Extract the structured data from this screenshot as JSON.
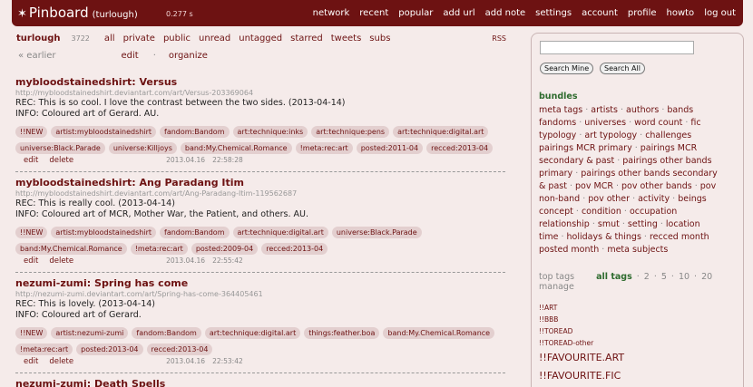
{
  "header": {
    "logo": "Pinboard",
    "username": "(turlough)",
    "timing": "0.277 s",
    "nav": [
      "network",
      "recent",
      "popular",
      "add url",
      "add note",
      "settings",
      "account",
      "profile",
      "howto",
      "log out"
    ]
  },
  "subbar": {
    "username": "turlough",
    "count": "3722",
    "filters": [
      "all",
      "private",
      "public",
      "unread",
      "untagged",
      "starred",
      "tweets",
      "subs"
    ],
    "rss": "RSS"
  },
  "pager": {
    "earlier": "« earlier",
    "edit": "edit",
    "dot": "·",
    "organize": "organize"
  },
  "bookmarks": [
    {
      "title": "mybloodstainedshirt: Versus",
      "url": "http://mybloodstainedshirt.deviantart.com/art/Versus-203369064",
      "desc": [
        "REC: This is so cool. I love the contrast between the two sides. (2013-04-14)",
        "INFO: Coloured art of Gerard. AU."
      ],
      "tags": [
        "!!NEW",
        "artist:mybloodstainedshirt",
        "fandom:Bandom",
        "art:technique:inks",
        "art:technique:pens",
        "art:technique:digital.art",
        "universe:Black.Parade",
        "universe:Killjoys",
        "band:My.Chemical.Romance",
        "!meta:rec:art",
        "posted:2011-04",
        "recced:2013-04"
      ],
      "edit": "edit",
      "delete": "delete",
      "date": "2013.04.16",
      "time": "22:58:28"
    },
    {
      "title": "mybloodstainedshirt: Ang Paradang Itim",
      "url": "http://mybloodstainedshirt.deviantart.com/art/Ang-Paradang-Itim-119562687",
      "desc": [
        "REC: This is really cool. (2013-04-14)",
        "INFO: Coloured art of MCR, Mother War, the Patient, and others. AU."
      ],
      "tags": [
        "!!NEW",
        "artist:mybloodstainedshirt",
        "fandom:Bandom",
        "art:technique:digital.art",
        "universe:Black.Parade",
        "band:My.Chemical.Romance",
        "!meta:rec:art",
        "posted:2009-04",
        "recced:2013-04"
      ],
      "edit": "edit",
      "delete": "delete",
      "date": "2013.04.16",
      "time": "22:55:42"
    },
    {
      "title": "nezumi-zumi: Spring has come",
      "url": "http://nezumi-zumi.deviantart.com/art/Spring-has-come-364405461",
      "desc": [
        "REC: This is lovely. (2013-04-14)",
        "INFO: Coloured art of Gerard."
      ],
      "tags": [
        "!!NEW",
        "artist:nezumi-zumi",
        "fandom:Bandom",
        "art:technique:digital.art",
        "things:feather.boa",
        "band:My.Chemical.Romance",
        "!meta:rec:art",
        "posted:2013-04",
        "recced:2013-04"
      ],
      "edit": "edit",
      "delete": "delete",
      "date": "2013.04.16",
      "time": "22:53:42"
    },
    {
      "title": "nezumi-zumi: Death Spells",
      "url": "",
      "desc": [],
      "tags": [],
      "edit": "",
      "delete": "",
      "date": "",
      "time": ""
    }
  ],
  "sidebar": {
    "search_placeholder": "",
    "search_mine": "Search Mine",
    "search_all": "Search All",
    "bundles_heading": "bundles",
    "bundle_lines": [
      [
        "meta tags",
        "artists",
        "authors",
        "bands"
      ],
      [
        "fandoms",
        "universes",
        "word count",
        "fic"
      ],
      [
        "typology",
        "art typology",
        "challenges"
      ],
      [
        "pairings MCR primary",
        "pairings MCR"
      ],
      [
        "secondary & past",
        "pairings other bands"
      ],
      [
        "primary",
        "pairings other bands secondary"
      ],
      [
        "& past",
        "pov MCR",
        "pov other bands",
        "pov"
      ],
      [
        "non-band",
        "pov other",
        "activity",
        "beings"
      ],
      [
        "concept",
        "condition",
        "occupation"
      ],
      [
        "relationship",
        "smut",
        "setting",
        "location"
      ],
      [
        "time",
        "holidays & things",
        "recced month"
      ],
      [
        "posted month",
        "meta subjects"
      ]
    ],
    "tag_nav": {
      "top": "top tags",
      "all": "all tags",
      "counts": [
        "2",
        "5",
        "10",
        "20"
      ],
      "manage": "manage"
    },
    "tags_small": [
      "!!ART",
      "!!BBB",
      "!!TOREAD",
      "!!TOREAD-other"
    ],
    "tags_large": [
      "!!FAVOURITE.ART",
      "!!FAVOURITE.FIC"
    ]
  }
}
